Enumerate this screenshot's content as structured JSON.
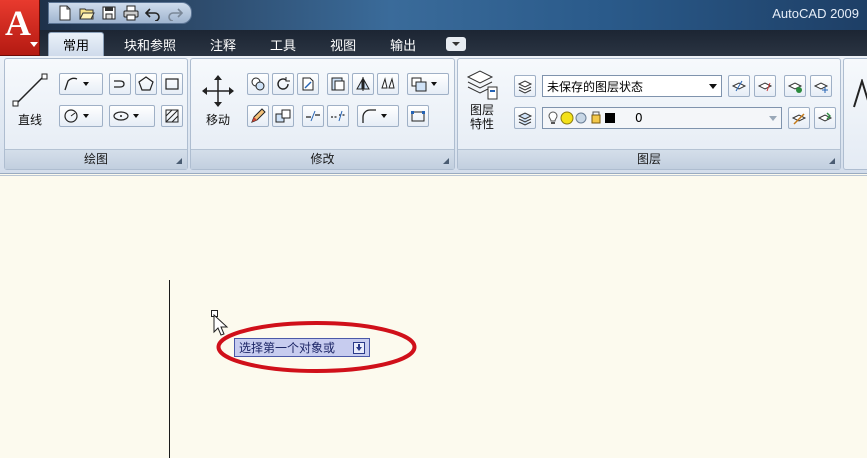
{
  "app": {
    "title": "AutoCAD 2009",
    "logo_letter": "A"
  },
  "tabs": [
    {
      "label": "常用",
      "active": true
    },
    {
      "label": "块和参照"
    },
    {
      "label": "注释"
    },
    {
      "label": "工具"
    },
    {
      "label": "视图"
    },
    {
      "label": "输出"
    }
  ],
  "panels": {
    "draw": {
      "title": "绘图",
      "line_label": "直线"
    },
    "modify": {
      "title": "修改",
      "move_label": "移动"
    },
    "layers": {
      "title": "图层",
      "properties_label_1": "图层",
      "properties_label_2": "特性",
      "layer_state": "未保存的图层状态",
      "current_layer": "0"
    }
  },
  "canvas": {
    "tooltip_prompt": "选择第一个对象或",
    "highlight_color": "#d0101a"
  }
}
